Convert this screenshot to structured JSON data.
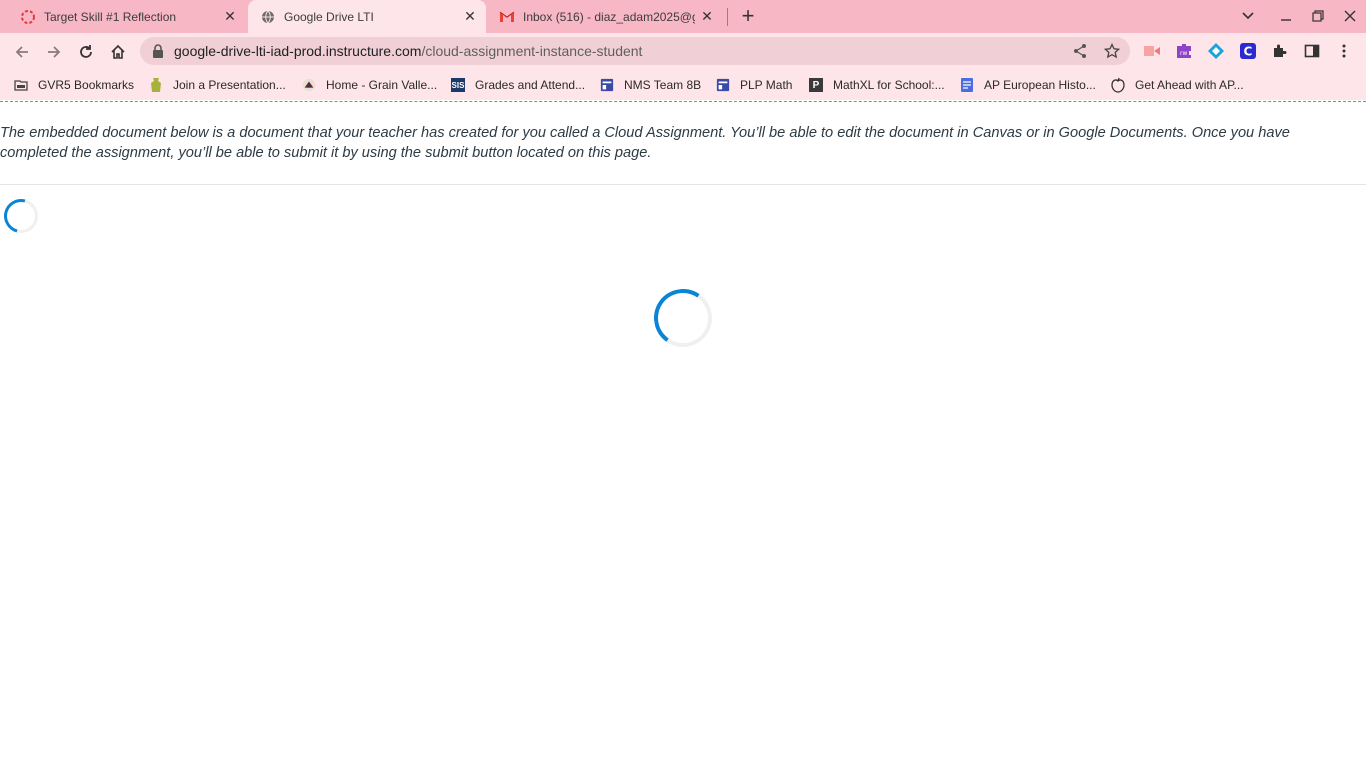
{
  "tabs": [
    {
      "title": "Target Skill #1 Reflection",
      "icon": "canvas-icon"
    },
    {
      "title": "Google Drive LTI",
      "icon": "globe-icon"
    },
    {
      "title": "Inbox (516) - diaz_adam2025@g",
      "icon": "gmail-icon"
    }
  ],
  "address_bar": {
    "domain": "google-drive-lti-iad-prod.instructure.com",
    "path": "/cloud-assignment-instance-student"
  },
  "bookmarks": [
    {
      "label": "GVR5 Bookmarks",
      "icon": "folder-icon"
    },
    {
      "label": "Join a Presentation...",
      "icon": "nearpod-icon"
    },
    {
      "label": "Home - Grain Valle...",
      "icon": "school-icon"
    },
    {
      "label": "Grades and Attend...",
      "icon": "sis-icon"
    },
    {
      "label": "NMS Team 8B",
      "icon": "classroom-icon"
    },
    {
      "label": "PLP Math",
      "icon": "classroom-icon"
    },
    {
      "label": "MathXL for School:...",
      "icon": "pearson-icon"
    },
    {
      "label": "AP European Histo...",
      "icon": "docs-icon"
    },
    {
      "label": "Get Ahead with AP...",
      "icon": "apple-icon"
    }
  ],
  "bookmark_badges": {
    "sis": "SIS",
    "pearson": "P"
  },
  "page": {
    "intro_text": "The embedded document below is a document that your teacher has created for you called a Cloud Assignment. You’ll be able to edit the document in Canvas or in Google Documents. Once you have completed the assignment, you’ll be able to submit it by using the submit button located on this page."
  },
  "colors": {
    "tabstrip": "#f8b7c4",
    "toolbar": "#fde5ea",
    "spinner": "#0a84d6"
  }
}
